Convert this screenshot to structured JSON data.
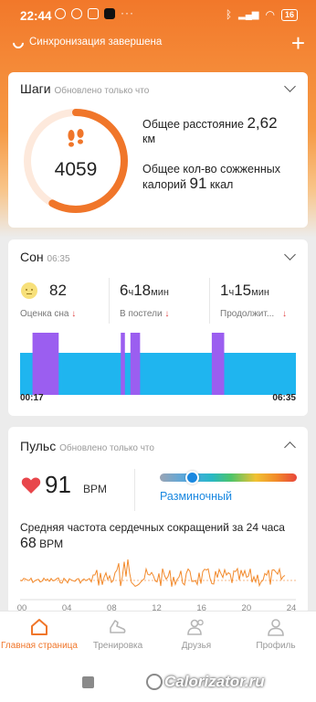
{
  "colors": {
    "accent": "#f0762a",
    "sleep_light": "#1fb5ef",
    "sleep_deep": "#9b5ef0",
    "pulse_line": "#f28a2c",
    "zone_blue": "#1a88e0"
  },
  "status_bar": {
    "time": "22:44",
    "battery": "16"
  },
  "sync": {
    "text": "Синхронизация завершена",
    "plus": "+"
  },
  "steps": {
    "title": "Шаги",
    "updated": "Обновлено только что",
    "value": "4059",
    "progress_fraction": 0.58,
    "distance_prefix": "Общее расстояние",
    "distance_value": "2,62",
    "distance_unit": "км",
    "calories_prefix": "Общее кол-во сожженных",
    "calories_prefix2": "калорий",
    "calories_value": "91",
    "calories_unit": "ккал"
  },
  "sleep": {
    "title": "Сон",
    "time": "06:35",
    "score_value": "82",
    "score_label": "Оценка сна",
    "in_bed_hours": "6",
    "in_bed_hours_unit": "ч",
    "in_bed_minutes": "18",
    "in_bed_minutes_unit": "мин",
    "in_bed_label": "В постели",
    "duration_hours": "1",
    "duration_hours_unit": "ч",
    "duration_minutes": "15",
    "duration_minutes_unit": "мин",
    "duration_label": "Продолжит...",
    "arrow": "↓",
    "start_time": "00:17",
    "end_time": "06:35"
  },
  "chart_data": {
    "type": "area",
    "title": "",
    "xlabel": "",
    "ylabel": "",
    "x_start": "00:17",
    "x_end": "06:35",
    "series": [
      {
        "name": "light",
        "segments": [
          [
            0.0,
            1.0
          ]
        ]
      },
      {
        "name": "deep",
        "segments": [
          [
            0.045,
            0.14
          ],
          [
            0.365,
            0.38
          ],
          [
            0.4,
            0.435
          ],
          [
            0.695,
            0.74
          ]
        ]
      }
    ]
  },
  "pulse": {
    "title": "Пульс",
    "updated": "Обновлено только что",
    "value": "91",
    "unit": "BPM",
    "zone_label": "Разминочный",
    "zone_fraction": 0.23,
    "avg_text": "Средняя частота сердечных сокращений за 24 часа",
    "avg_value": "68",
    "avg_unit": "BPM",
    "ticks": [
      "00",
      "04",
      "08",
      "12",
      "16",
      "20",
      "24"
    ]
  },
  "nav": {
    "items": [
      {
        "label": "Главная страница",
        "icon": "home-icon",
        "active": true
      },
      {
        "label": "Тренировка",
        "icon": "sneaker-icon",
        "active": false
      },
      {
        "label": "Друзья",
        "icon": "friends-icon",
        "active": false
      },
      {
        "label": "Профиль",
        "icon": "profile-icon",
        "active": false
      }
    ]
  },
  "watermark": "Calorizator.ru"
}
